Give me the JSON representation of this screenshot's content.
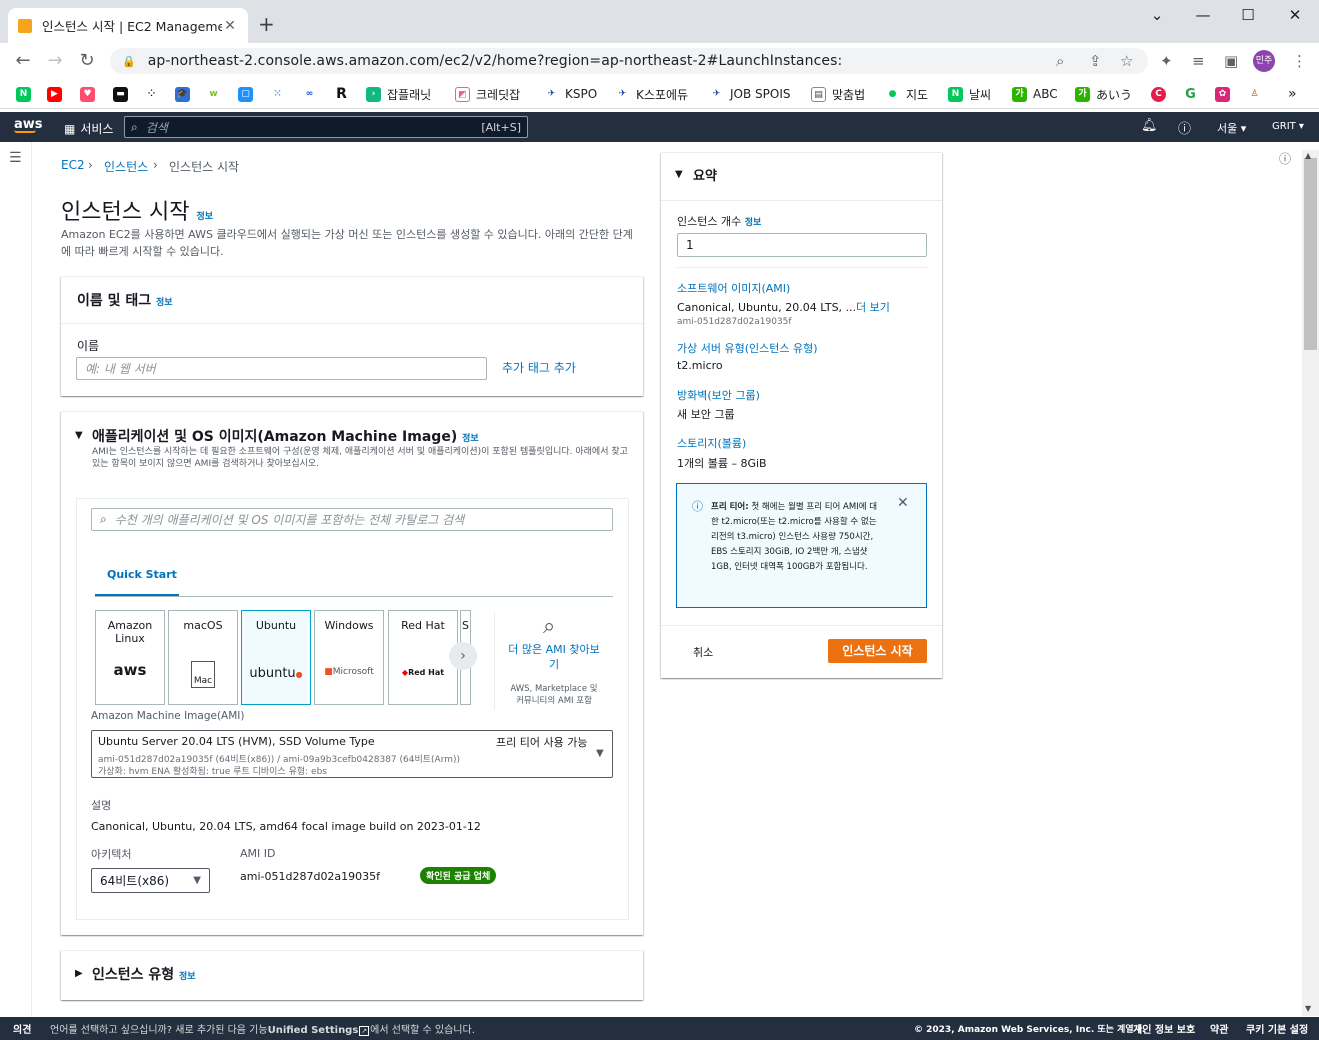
{
  "browser": {
    "tab_title": "인스턴스 시작 | EC2 Management",
    "url": "ap-northeast-2.console.aws.amazon.com/ec2/v2/home?region=ap-northeast-2#LaunchInstances:",
    "profile": "민주",
    "bookmarks": [
      "잡플래닛",
      "크레딧잡",
      "KSPO",
      "K스포에듀",
      "JOB SPOIS",
      "맞춤법",
      "지도",
      "날씨",
      "ABC",
      "あいう"
    ]
  },
  "aws_header": {
    "logo": "aws",
    "services": "서비스",
    "search_placeholder": "검색",
    "search_shortcut": "[Alt+S]",
    "region": "서울 ▾",
    "account": "GRIT ▾"
  },
  "breadcrumb": {
    "ec2": "EC2",
    "instances": "인스턴스",
    "current": "인스턴스 시작"
  },
  "page": {
    "title": "인스턴스 시작",
    "info": "정보",
    "description": "Amazon EC2를 사용하면 AWS 클라우드에서 실행되는 가상 머신 또는 인스턴스를 생성할 수 있습니다. 아래의 간단한 단계에 따라 빠르게 시작할 수 있습니다."
  },
  "name_tags": {
    "header": "이름 및 태그",
    "info": "정보",
    "name_label": "이름",
    "name_placeholder": "예: 내 웹 서버",
    "add_tags": "추가 태그 추가"
  },
  "ami_section": {
    "header": "애플리케이션 및 OS 이미지(Amazon Machine Image)",
    "info": "정보",
    "description": "AMI는 인스턴스를 시작하는 데 필요한 소프트웨어 구성(운영 체제, 애플리케이션 서버 및 애플리케이션)이 포함된 템플릿입니다. 아래에서 찾고 있는 항목이 보이지 않으면 AMI를 검색하거나 찾아보십시오.",
    "search_placeholder": "수천 개의 애플리케이션 및 OS 이미지를 포함하는 전체 카탈로그 검색",
    "tab_quick_start": "Quick Start",
    "tiles": [
      {
        "name": "Amazon Linux",
        "logo": "aws"
      },
      {
        "name": "macOS",
        "logo": "Mac"
      },
      {
        "name": "Ubuntu",
        "logo": "ubuntu"
      },
      {
        "name": "Windows",
        "logo": "Microsoft"
      },
      {
        "name": "Red Hat",
        "logo": "Red Hat"
      },
      {
        "name": "S",
        "logo": ""
      }
    ],
    "browse_more": "더 많은 AMI 찾아보기",
    "browse_more_sub": "AWS, Marketplace 및 커뮤니티의 AMI 포함",
    "ami_label": "Amazon Machine Image(AMI)",
    "ami_selected": "Ubuntu Server 20.04 LTS (HVM), SSD Volume Type",
    "ami_free": "프리 티어 사용 가능",
    "ami_ids": "ami-051d287d02a19035f (64비트(x86)) / ami-09a9b3cefb0428387 (64비트(Arm))",
    "ami_meta": "가상화: hvm    ENA 활성화됨: true    루트 디바이스 유형: ebs",
    "desc_label": "설명",
    "desc_value": "Canonical, Ubuntu, 20.04 LTS, amd64 focal image build on 2023-01-12",
    "arch_label": "아키텍처",
    "arch_value": "64비트(x86)",
    "ami_id_label": "AMI ID",
    "ami_id_value": "ami-051d287d02a19035f",
    "verified": "확인된 공급 업체"
  },
  "instance_type": {
    "header": "인스턴스 유형",
    "info": "정보"
  },
  "summary": {
    "header": "요약",
    "count_label": "인스턴스 개수",
    "count_info": "정보",
    "count_value": "1",
    "ami_link": "소프트웨어 이미지(AMI)",
    "ami_value": "Canonical, Ubuntu, 20.04 LTS, ...",
    "ami_more": "더 보기",
    "ami_id": "ami-051d287d02a19035f",
    "type_link": "가상 서버 유형(인스턴스 유형)",
    "type_value": "t2.micro",
    "fw_link": "방화벽(보안 그룹)",
    "fw_value": "새 보안 그룹",
    "storage_link": "스토리지(볼륨)",
    "storage_value": "1개의 볼륨 – 8GiB",
    "free_tier_title": "프리 티어:",
    "free_tier_text": "첫 해에는 월별 프리 티어 AMI에 대한 t2.micro(또는 t2.micro를 사용할 수 없는 리전의 t3.micro) 인스턴스 사용량 750시간, EBS 스토리지 30GiB, IO 2백만 개, 스냅샷 1GB, 인터넷 대역폭 100GB가 포함됩니다.",
    "cancel": "취소",
    "launch": "인스턴스 시작"
  },
  "footer": {
    "feedback": "의견",
    "lang_text": "언어를 선택하고 싶으십니까? 새로 추가된 다음 기능",
    "unified": "Unified Settings",
    "lang_text2": "에서 선택할 수 있습니다.",
    "copyright": "© 2023, Amazon Web Services, Inc. 또는 계열사.",
    "privacy": "개인 정보 보호",
    "terms": "약관",
    "cookies": "쿠키 기본 설정"
  },
  "colors": {
    "aws_nav": "#232f3e",
    "link": "#0073bb",
    "orange": "#ec7211",
    "green": "#1d8102"
  }
}
